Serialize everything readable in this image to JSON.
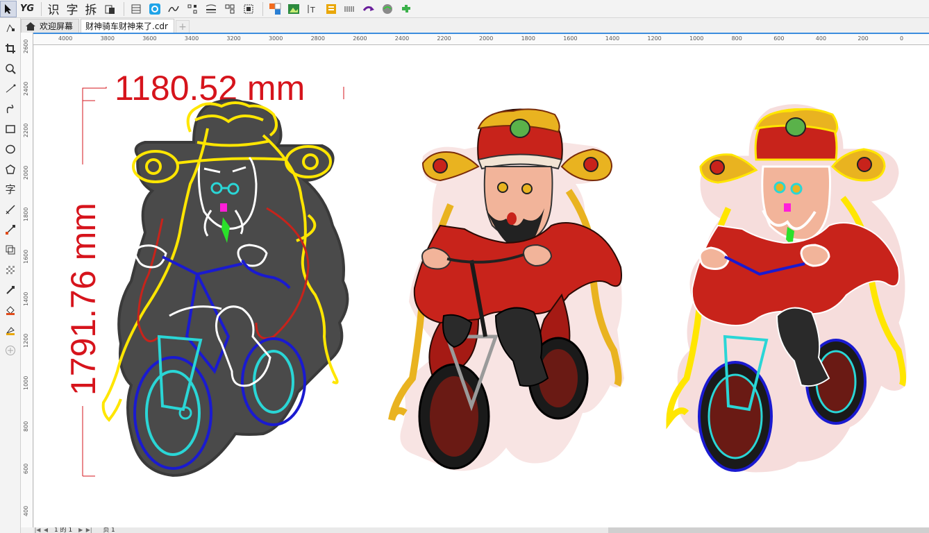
{
  "toolbar": {
    "items": [
      "YG",
      "识",
      "字",
      "拆"
    ]
  },
  "tabs": {
    "welcome": "欢迎屏幕",
    "document": "财神骑车财神来了.cdr",
    "add": "+"
  },
  "ruler": {
    "h_labels": [
      "4000",
      "3800",
      "3600",
      "3400",
      "3200",
      "3000",
      "2800",
      "2600",
      "2400",
      "2200",
      "2000",
      "1800",
      "1600",
      "1400",
      "1200",
      "1000",
      "800",
      "600",
      "400",
      "200",
      "0"
    ],
    "v_labels": [
      "2600",
      "2400",
      "2200",
      "2000",
      "1800",
      "1600",
      "1400",
      "1200",
      "1000",
      "800",
      "600",
      "400"
    ]
  },
  "dimensions": {
    "width": "1180.52 mm",
    "height": "1791.76 mm"
  },
  "status": {
    "page_of": "1 的 1",
    "page_tab": "页 1"
  },
  "colors": {
    "dimension": "#d6141c",
    "neon_yellow": "#ffe600",
    "neon_blue": "#1a1ad0",
    "neon_cyan": "#2ad6d6",
    "body_gray": "#4a4a4a",
    "robe_red": "#c8231b"
  }
}
